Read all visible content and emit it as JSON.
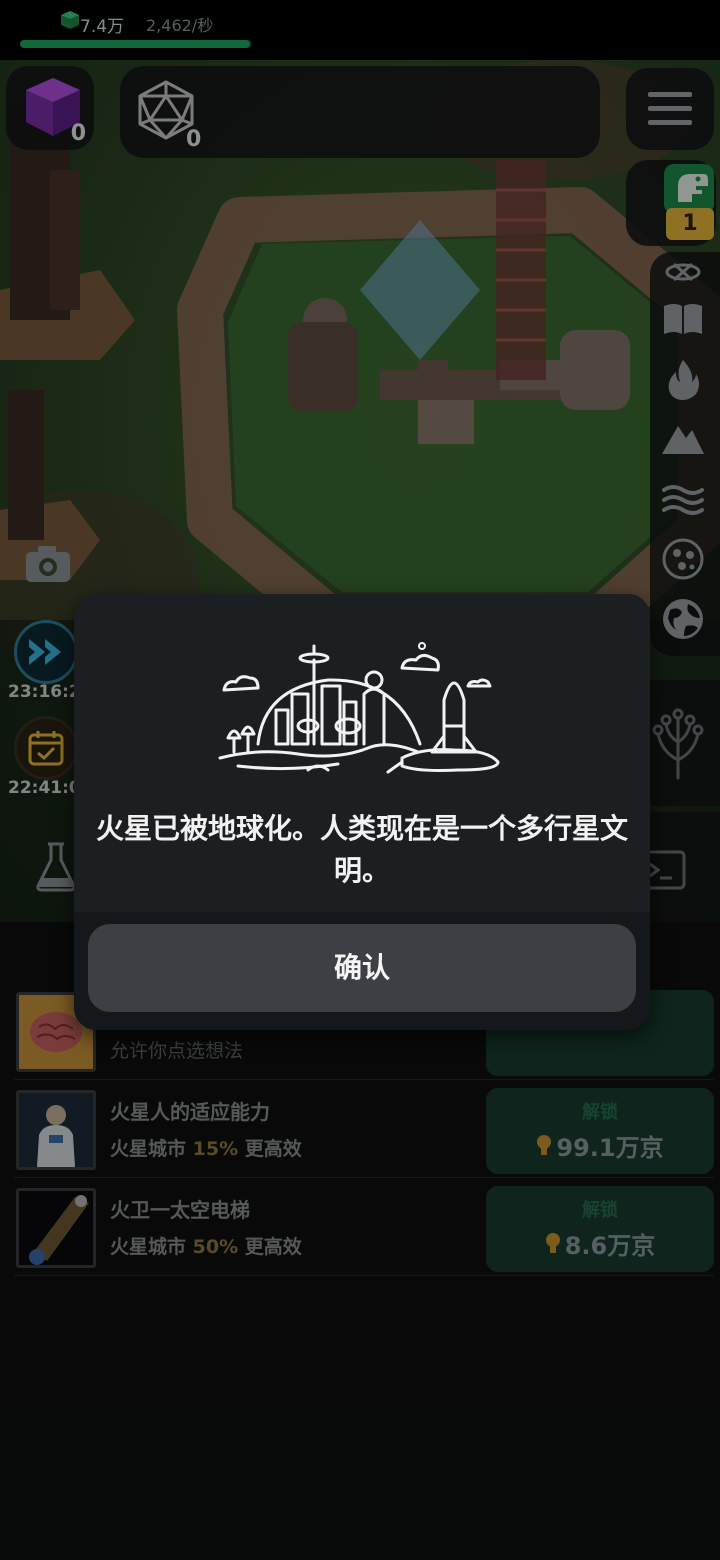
{
  "hud": {
    "cube_count": "0",
    "d20_count": "0",
    "resource_amount": "7.4万",
    "resource_rate": "2,462/秒",
    "resource_progress": 0.99,
    "dino_badge": "1"
  },
  "side_left": {
    "timer_speed": "23:16:2",
    "timer_calendar": "22:41:0"
  },
  "research": {
    "items": [
      {
        "title": "",
        "desc": "允许你点选想法",
        "thumb": "brain"
      },
      {
        "title": "火星人的适应能力",
        "desc_prefix": "火星城市",
        "desc_pct": "15%",
        "desc_suffix": "更高效",
        "unlock_label": "解锁",
        "cost": "99.1万京",
        "thumb": "astronaut"
      },
      {
        "title": "火卫一太空电梯",
        "desc_prefix": "火星城市",
        "desc_pct": "50%",
        "desc_suffix": "更高效",
        "unlock_label": "解锁",
        "cost": "8.6万京",
        "thumb": "space-elevator"
      }
    ]
  },
  "modal": {
    "message": "火星已被地球化。人类现在是一个多行星文明。",
    "confirm_label": "确认"
  },
  "colors": {
    "accent_green": "#1fa860",
    "unlock_bg": "#183b2e",
    "badge_gold": "#e7b73a",
    "highlight_pct": "#8f7a3c"
  }
}
